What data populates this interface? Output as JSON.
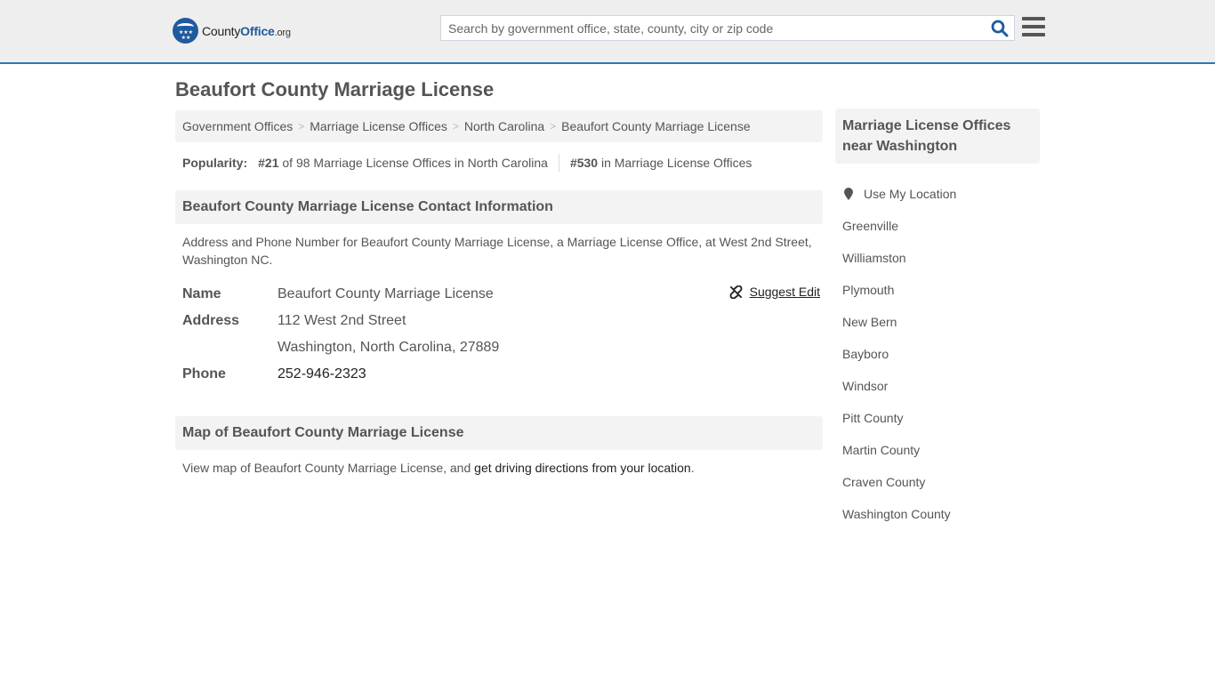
{
  "header": {
    "logo": {
      "part1": "County",
      "part2": "Office",
      "part3": ".org"
    },
    "search_placeholder": "Search by government office, state, county, city or zip code",
    "brand_color": "#1f5a9e",
    "accent_color": "#2a77b5"
  },
  "page_title": "Beaufort County Marriage License",
  "breadcrumb": [
    "Government Offices",
    "Marriage License Offices",
    "North Carolina",
    "Beaufort County Marriage License"
  ],
  "popularity": {
    "label": "Popularity:",
    "state_rank": "#21",
    "state_text": "of 98 Marriage License Offices in North Carolina",
    "national_rank": "#530",
    "national_text": "in Marriage License Offices"
  },
  "contact": {
    "heading": "Beaufort County Marriage License Contact Information",
    "description": "Address and Phone Number for Beaufort County Marriage License, a Marriage License Office, at West 2nd Street, Washington NC.",
    "suggest_edit": "Suggest Edit",
    "rows": {
      "name_label": "Name",
      "name_value": "Beaufort County Marriage License",
      "address_label": "Address",
      "address_line1": "112 West 2nd Street",
      "address_line2": "Washington, North Carolina, 27889",
      "phone_label": "Phone",
      "phone_value": "252-946-2323"
    }
  },
  "map": {
    "heading": "Map of Beaufort County Marriage License",
    "text_before": "View map of Beaufort County Marriage License, and ",
    "link": "get driving directions from your location",
    "text_after": "."
  },
  "sidebar": {
    "heading": "Marriage License Offices near Washington",
    "use_location": "Use My Location",
    "items": [
      "Greenville",
      "Williamston",
      "Plymouth",
      "New Bern",
      "Bayboro",
      "Windsor",
      "Pitt County",
      "Martin County",
      "Craven County",
      "Washington County"
    ]
  }
}
